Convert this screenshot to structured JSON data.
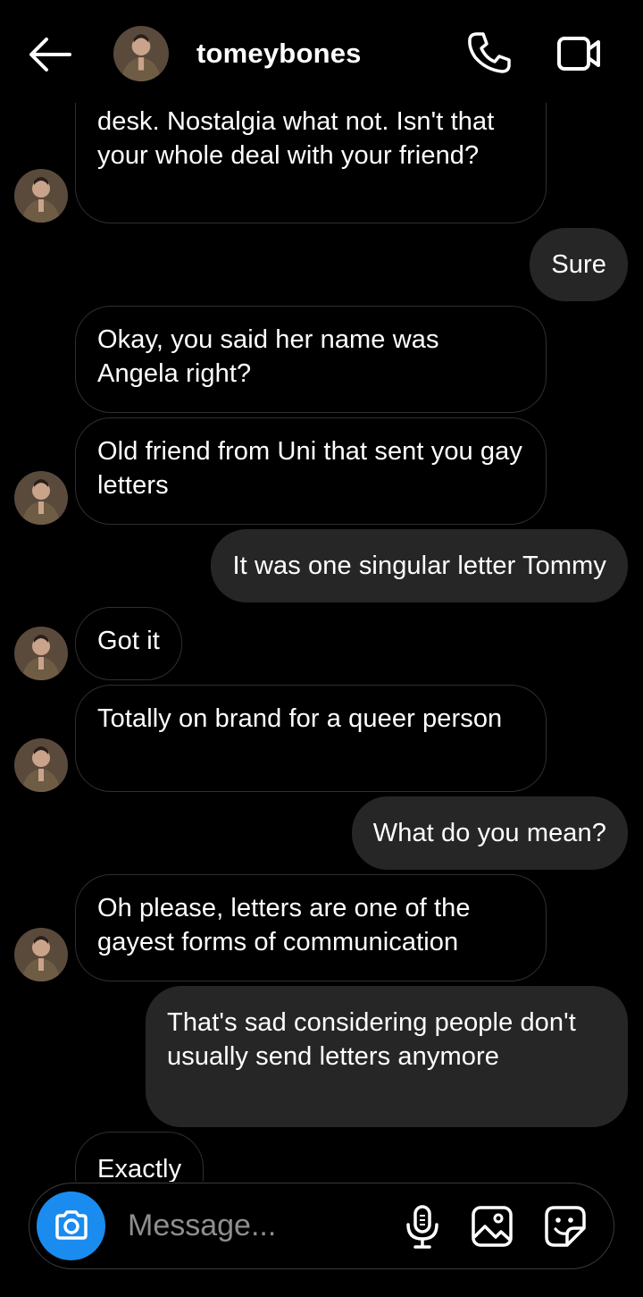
{
  "header": {
    "username": "tomeybones",
    "back_icon": "arrow-left-icon",
    "call_icon": "phone-icon",
    "video_icon": "video-camera-icon"
  },
  "messages": [
    {
      "sender": "them",
      "text": "desk. Nostalgia what not. Isn't that your whole deal with your friend?",
      "avatar": true
    },
    {
      "sender": "me",
      "text": "Sure"
    },
    {
      "sender": "them",
      "text": "Okay, you said her name was Angela right?",
      "avatar": false
    },
    {
      "sender": "them",
      "text": "Old friend from Uni that sent you gay letters",
      "avatar": true
    },
    {
      "sender": "me",
      "text": "It was one singular letter Tommy"
    },
    {
      "sender": "them",
      "text": "Got it",
      "avatar": true
    },
    {
      "sender": "them",
      "text": "Totally on brand for a queer person",
      "avatar": true
    },
    {
      "sender": "me",
      "text": "What do you mean?"
    },
    {
      "sender": "them",
      "text": "Oh please, letters are one of the gayest forms of communication",
      "avatar": true
    },
    {
      "sender": "me",
      "text": "That's sad considering people don't usually send letters anymore"
    },
    {
      "sender": "them",
      "text": "Exactly",
      "avatar": false
    }
  ],
  "composer": {
    "placeholder": "Message...",
    "camera_icon": "camera-icon",
    "mic_icon": "microphone-icon",
    "gallery_icon": "image-icon",
    "sticker_icon": "sticker-icon"
  },
  "colors": {
    "background": "#000000",
    "outgoing_bubble": "#262626",
    "incoming_border": "#2f2f2f",
    "camera_button": "#1a8cf0",
    "placeholder": "#8e8e8e"
  }
}
